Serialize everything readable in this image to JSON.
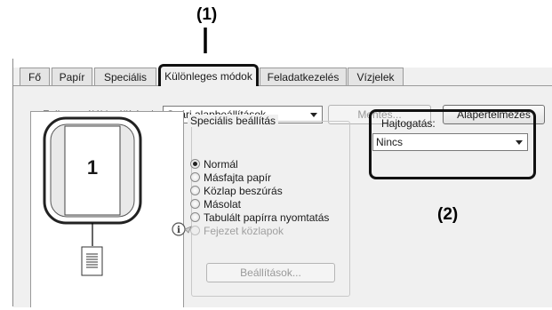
{
  "callouts": {
    "tab_callout": "(1)",
    "dropdown_callout": "(2)"
  },
  "tabs": [
    {
      "label": "Fő"
    },
    {
      "label": "Papír"
    },
    {
      "label": "Speciális"
    },
    {
      "label": "Különleges módok"
    },
    {
      "label": "Feladatkezelés"
    },
    {
      "label": "Vízjelek"
    }
  ],
  "user_settings": {
    "label": "Felhasználói beállítások:",
    "selected": "Gyári alapbeállítások",
    "save_label": "Mentés...",
    "defaults_label": "Alapértelmezés"
  },
  "preview": {
    "page_number": "1"
  },
  "special": {
    "group_title": "Speciális beállítás",
    "options": [
      {
        "label": "Normál",
        "selected": true,
        "enabled": true
      },
      {
        "label": "Másfajta papír",
        "selected": false,
        "enabled": true
      },
      {
        "label": "Közlap beszúrás",
        "selected": false,
        "enabled": true
      },
      {
        "label": "Másolat",
        "selected": false,
        "enabled": true
      },
      {
        "label": "Tabulált papírra nyomtatás",
        "selected": false,
        "enabled": true
      },
      {
        "label": "Fejezet közlapok",
        "selected": false,
        "enabled": false
      }
    ],
    "settings_button": "Beállítások..."
  },
  "folding": {
    "label": "Hajtogatás:",
    "selected": "Nincs"
  },
  "colors": {
    "highlight_border": "#111111",
    "dialog_bg": "#f0f0f0"
  }
}
